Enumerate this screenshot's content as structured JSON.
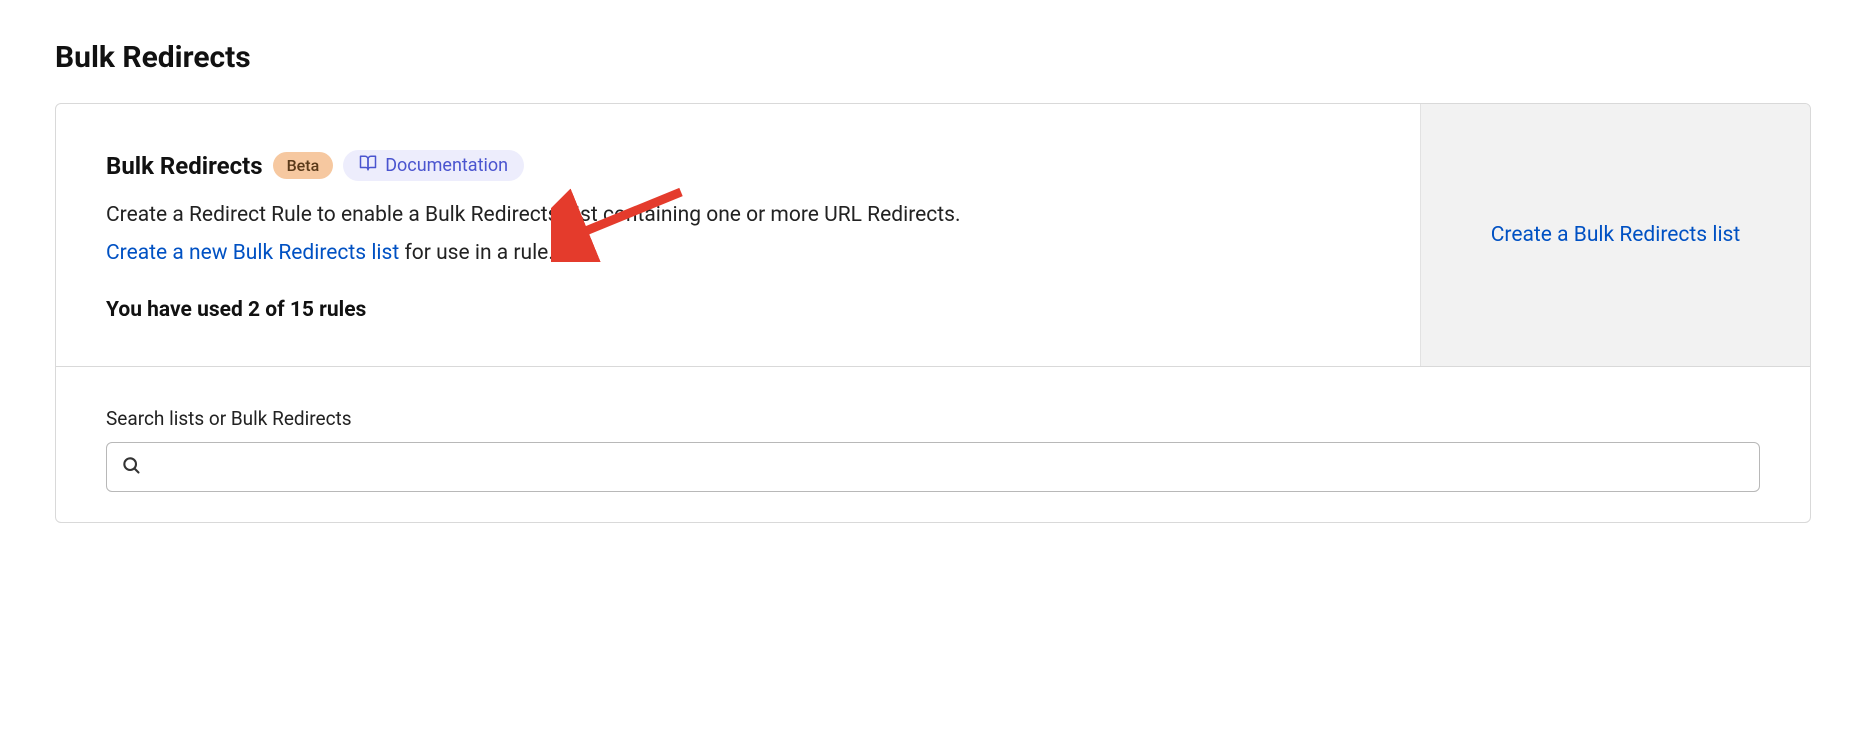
{
  "page": {
    "title": "Bulk Redirects"
  },
  "section": {
    "title": "Bulk Redirects",
    "beta_label": "Beta",
    "doc_label": "Documentation",
    "description": "Create a Redirect Rule to enable a Bulk Redirects List containing one or more URL Redirects.",
    "create_link_text": "Create a new Bulk Redirects list",
    "create_link_suffix": " for use in a rule.",
    "usage_text": "You have used 2 of 15 rules",
    "cta_text": "Create a Bulk Redirects list"
  },
  "search": {
    "label": "Search lists or Bulk Redirects",
    "value": ""
  }
}
